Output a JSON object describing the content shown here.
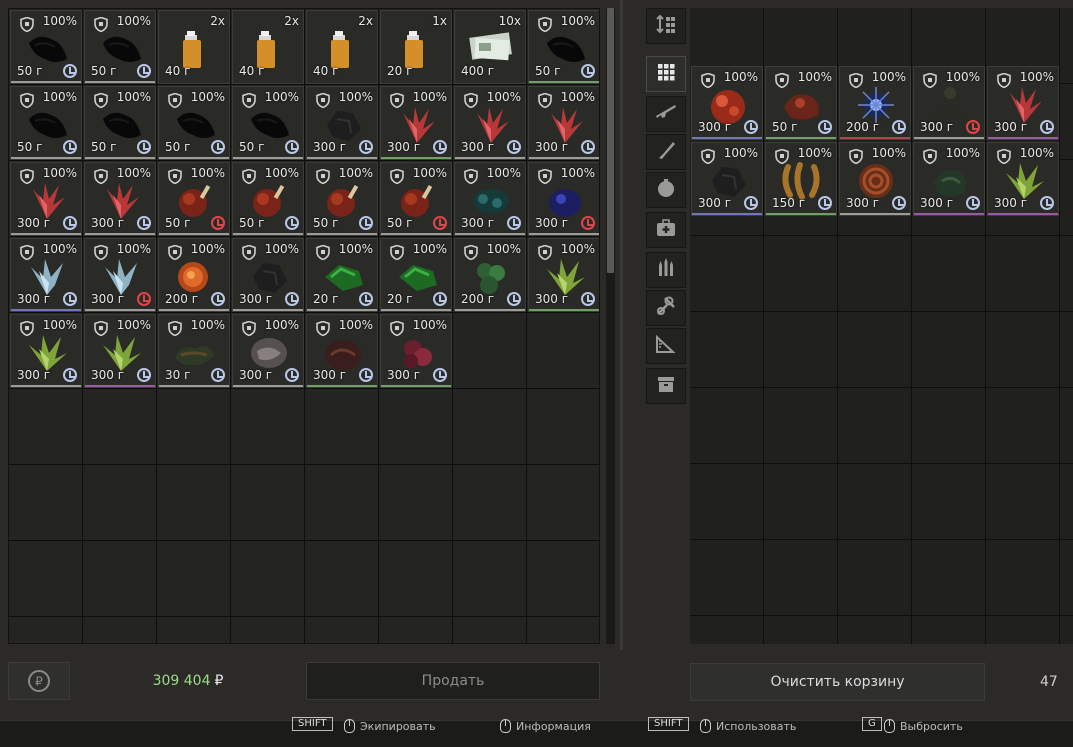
{
  "inventory": {
    "items": [
      {
        "pct": "100%",
        "price": "50 г",
        "kind": "black",
        "timer": "normal",
        "rarity": "gray"
      },
      {
        "pct": "100%",
        "price": "50 г",
        "kind": "black",
        "timer": "normal",
        "rarity": "gray"
      },
      {
        "pct": "2x",
        "price": "40 г",
        "kind": "lighter",
        "timer": "none",
        "rarity": "none"
      },
      {
        "pct": "2x",
        "price": "40 г",
        "kind": "lighter",
        "timer": "none",
        "rarity": "none"
      },
      {
        "pct": "2x",
        "price": "40 г",
        "kind": "lighter",
        "timer": "none",
        "rarity": "none"
      },
      {
        "pct": "1x",
        "price": "20 г",
        "kind": "lighter",
        "timer": "none",
        "rarity": "none"
      },
      {
        "pct": "10x",
        "price": "400 г",
        "kind": "money",
        "timer": "none",
        "rarity": "none"
      },
      {
        "pct": "100%",
        "price": "50 г",
        "kind": "black",
        "timer": "normal",
        "rarity": "green"
      },
      {
        "pct": "100%",
        "price": "50 г",
        "kind": "black",
        "timer": "normal",
        "rarity": "gray"
      },
      {
        "pct": "100%",
        "price": "50 г",
        "kind": "black",
        "timer": "normal",
        "rarity": "gray"
      },
      {
        "pct": "100%",
        "price": "50 г",
        "kind": "black",
        "timer": "normal",
        "rarity": "gray"
      },
      {
        "pct": "100%",
        "price": "50 г",
        "kind": "black",
        "timer": "normal",
        "rarity": "gray"
      },
      {
        "pct": "100%",
        "price": "300 г",
        "kind": "darkrock",
        "timer": "normal",
        "rarity": "gray"
      },
      {
        "pct": "100%",
        "price": "300 г",
        "kind": "redcrystal",
        "timer": "normal",
        "rarity": "green"
      },
      {
        "pct": "100%",
        "price": "300 г",
        "kind": "redcrystal",
        "timer": "normal",
        "rarity": "gray"
      },
      {
        "pct": "100%",
        "price": "300 г",
        "kind": "redcrystal",
        "timer": "normal",
        "rarity": "gray"
      },
      {
        "pct": "100%",
        "price": "300 г",
        "kind": "redcrystal",
        "timer": "normal",
        "rarity": "gray"
      },
      {
        "pct": "100%",
        "price": "300 г",
        "kind": "redcrystal",
        "timer": "normal",
        "rarity": "gray"
      },
      {
        "pct": "100%",
        "price": "50 г",
        "kind": "meat",
        "timer": "red",
        "rarity": "gray"
      },
      {
        "pct": "100%",
        "price": "50 г",
        "kind": "meat",
        "timer": "normal",
        "rarity": "gray"
      },
      {
        "pct": "100%",
        "price": "50 г",
        "kind": "meat",
        "timer": "normal",
        "rarity": "gray"
      },
      {
        "pct": "100%",
        "price": "50 г",
        "kind": "meat",
        "timer": "red",
        "rarity": "gray"
      },
      {
        "pct": "100%",
        "price": "300 г",
        "kind": "teal",
        "timer": "normal",
        "rarity": "gray"
      },
      {
        "pct": "100%",
        "price": "300 г",
        "kind": "bluerock",
        "timer": "red",
        "rarity": "gray"
      },
      {
        "pct": "100%",
        "price": "300 г",
        "kind": "bluecrystal",
        "timer": "normal",
        "rarity": "blue"
      },
      {
        "pct": "100%",
        "price": "300 г",
        "kind": "bluecrystal",
        "timer": "red",
        "rarity": "gray"
      },
      {
        "pct": "100%",
        "price": "200 г",
        "kind": "orangeorb",
        "timer": "normal",
        "rarity": "gray"
      },
      {
        "pct": "100%",
        "price": "300 г",
        "kind": "darkrock",
        "timer": "normal",
        "rarity": "gray"
      },
      {
        "pct": "100%",
        "price": "20 г",
        "kind": "greenshard",
        "timer": "normal",
        "rarity": "gray"
      },
      {
        "pct": "100%",
        "price": "20 г",
        "kind": "greenshard",
        "timer": "normal",
        "rarity": "gray"
      },
      {
        "pct": "100%",
        "price": "200 г",
        "kind": "greenballs",
        "timer": "normal",
        "rarity": "gray"
      },
      {
        "pct": "100%",
        "price": "300 г",
        "kind": "greencrystal",
        "timer": "normal",
        "rarity": "green"
      },
      {
        "pct": "100%",
        "price": "300 г",
        "kind": "greencrystal",
        "timer": "normal",
        "rarity": "gray"
      },
      {
        "pct": "100%",
        "price": "300 г",
        "kind": "greencrystal",
        "timer": "normal",
        "rarity": "purple"
      },
      {
        "pct": "100%",
        "price": "30 г",
        "kind": "moss",
        "timer": "normal",
        "rarity": "gray"
      },
      {
        "pct": "100%",
        "price": "300 г",
        "kind": "grayrock",
        "timer": "normal",
        "rarity": "gray"
      },
      {
        "pct": "100%",
        "price": "300 г",
        "kind": "brownrock",
        "timer": "normal",
        "rarity": "green"
      },
      {
        "pct": "100%",
        "price": "300 г",
        "kind": "pinkrock",
        "timer": "normal",
        "rarity": "green"
      }
    ]
  },
  "toolbar": {
    "tools": [
      {
        "icon": "sort-icon",
        "active": false
      },
      {
        "icon": "grid-icon",
        "active": true
      },
      {
        "icon": "rifle-icon",
        "active": false
      },
      {
        "icon": "knife-icon",
        "active": false
      },
      {
        "icon": "grenade-icon",
        "active": false
      },
      {
        "icon": "medkit-icon",
        "active": false
      },
      {
        "icon": "ammo-icon",
        "active": false
      },
      {
        "icon": "tools-icon",
        "active": false
      },
      {
        "icon": "ruler-icon",
        "active": false
      },
      {
        "icon": "box-icon",
        "active": false
      }
    ]
  },
  "cart": {
    "items": [
      {
        "pct": "100%",
        "price": "300 г",
        "kind": "redbubble",
        "timer": "normal",
        "rarity": "blue"
      },
      {
        "pct": "100%",
        "price": "50 г",
        "kind": "redrock",
        "timer": "normal",
        "rarity": "green"
      },
      {
        "pct": "100%",
        "price": "200 г",
        "kind": "bluespark",
        "timer": "normal",
        "rarity": "red"
      },
      {
        "pct": "100%",
        "price": "300 г",
        "kind": "rootplant",
        "timer": "red",
        "rarity": "gray"
      },
      {
        "pct": "100%",
        "price": "300 г",
        "kind": "redcrystal",
        "timer": "normal",
        "rarity": "purple"
      },
      {
        "pct": "100%",
        "price": "300 г",
        "kind": "darkrock",
        "timer": "normal",
        "rarity": "blue"
      },
      {
        "pct": "100%",
        "price": "150 г",
        "kind": "sausage",
        "timer": "normal",
        "rarity": "green"
      },
      {
        "pct": "100%",
        "price": "300 г",
        "kind": "coil",
        "timer": "normal",
        "rarity": "gray"
      },
      {
        "pct": "100%",
        "price": "300 г",
        "kind": "darkgreen",
        "timer": "normal",
        "rarity": "purple"
      },
      {
        "pct": "100%",
        "price": "300 г",
        "kind": "greencrystal",
        "timer": "normal",
        "rarity": "purple"
      }
    ],
    "total_partial": "47",
    "clear_label": "Очистить корзину"
  },
  "footer": {
    "balance": "309 404",
    "currency": "₽",
    "sell_label": "Продать",
    "ruble_icon": "ruble-icon"
  },
  "hints": [
    {
      "key": "SHIFT",
      "text": "Экипировать"
    },
    {
      "key": "",
      "text": "Информация"
    },
    {
      "key": "SHIFT",
      "text": "Использовать"
    },
    {
      "key": "G",
      "text": "Выбросить"
    }
  ],
  "colors": {
    "balance": "#9bdc8a",
    "timer_normal": "#b9c7e8",
    "timer_red": "#e0454a"
  }
}
